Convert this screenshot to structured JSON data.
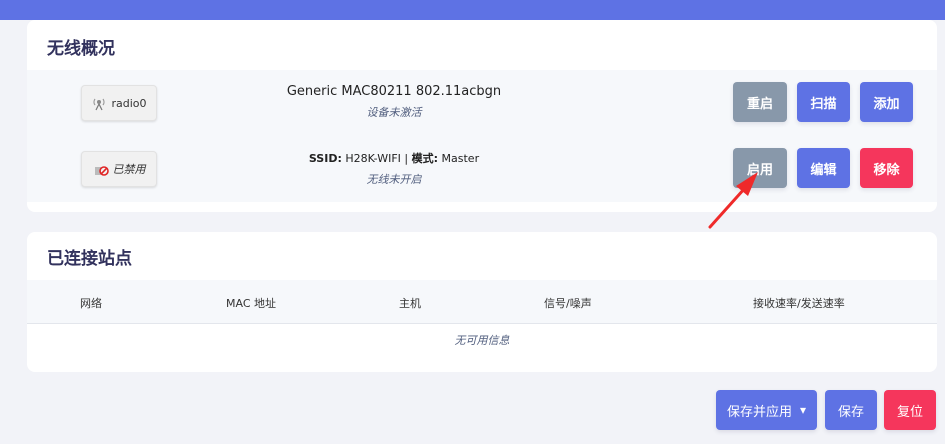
{
  "colors": {
    "primary": "#5e72e4",
    "gray": "#8898aa",
    "danger": "#f5365c",
    "arrow": "#ef2a2a"
  },
  "wireless": {
    "title": "无线概况",
    "radio": {
      "badge_label": "radio0",
      "badge_icon": "wifi-radio-icon",
      "name": "Generic MAC80211 802.11acbgn",
      "status": "设备未激活",
      "buttons": {
        "restart": "重启",
        "scan": "扫描",
        "add": "添加"
      }
    },
    "network": {
      "badge_label": "已禁用",
      "badge_icon": "wifi-disabled-icon",
      "ssid_label": "SSID:",
      "ssid_value": "H28K-WIFI",
      "separator": "|",
      "mode_label": "模式:",
      "mode_value": "Master",
      "status": "无线未开启",
      "buttons": {
        "enable": "启用",
        "edit": "编辑",
        "remove": "移除"
      }
    }
  },
  "stations": {
    "title": "已连接站点",
    "columns": [
      "网络",
      "MAC 地址",
      "主机",
      "信号/噪声",
      "接收速率/发送速率"
    ],
    "empty_text": "无可用信息"
  },
  "footer": {
    "save_apply": "保存并应用",
    "save_apply_caret": "▾",
    "save": "保存",
    "reset": "复位"
  },
  "annotation": {
    "type": "arrow",
    "target": "enable-button",
    "icon": "red-arrow-icon"
  }
}
